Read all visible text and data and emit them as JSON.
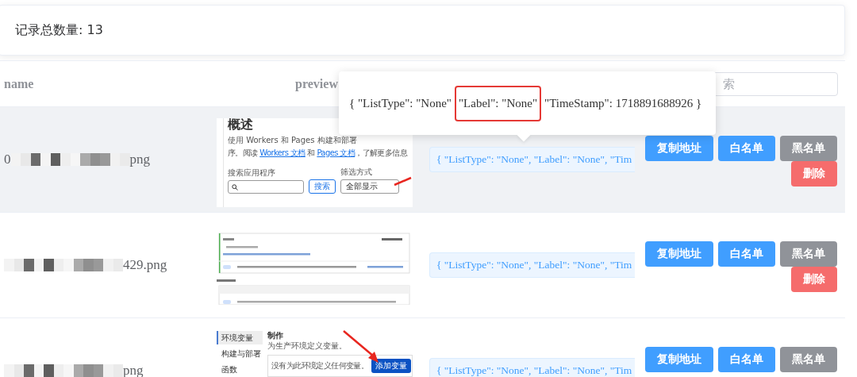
{
  "summary": {
    "label": "记录总数量: 13"
  },
  "table": {
    "columns": [
      {
        "label": "name"
      },
      {
        "label": "preview"
      }
    ],
    "search": {
      "placeholder": "索"
    },
    "rows": [
      {
        "highlighted": true,
        "name": {
          "prefix": "0",
          "suffix": "png"
        },
        "preview": {
          "kind": "overview",
          "title": "概述",
          "line_1": "使用 Workers 和 Pages 构建和部署",
          "line_2_start": "序。阅读 ",
          "link_1": "Workers 文档",
          "middle": " 和 ",
          "link_2": "Pages 文档",
          "line_2_end": "，了解更多信息",
          "search_label": "搜索应用程序",
          "search_button": "搜索",
          "filter_label": "筛选方式",
          "filter_value": "全部显示",
          "arrow": true
        },
        "metadata": "{ \"ListType\": \"None\", \"Label\": \"None\", \"Tim",
        "buttons": [
          {
            "label": "复制地址",
            "kind": "primary"
          },
          {
            "label": "白名单",
            "kind": "primary"
          },
          {
            "label": "黑名单",
            "kind": "info"
          },
          {
            "label": "删除",
            "kind": "danger"
          }
        ]
      },
      {
        "highlighted": false,
        "name": {
          "suffix": "429.png"
        },
        "preview": {
          "kind": "deployments"
        },
        "metadata": "{ \"ListType\": \"None\", \"Label\": \"None\", \"Tim",
        "buttons": [
          {
            "label": "复制地址",
            "kind": "primary"
          },
          {
            "label": "白名单",
            "kind": "primary"
          },
          {
            "label": "黑名单",
            "kind": "info"
          },
          {
            "label": "删除",
            "kind": "danger"
          }
        ]
      },
      {
        "highlighted": false,
        "name": {
          "suffix": "png"
        },
        "preview": {
          "kind": "variables",
          "nav": [
            {
              "label": "环境变量",
              "selected": true
            },
            {
              "label": "构建与部署",
              "selected": false
            },
            {
              "label": "函数",
              "selected": false
            }
          ],
          "heading": "制作",
          "subtitle": "为生产环境定义变量。",
          "empty": "没有为此环境定义任何变量。",
          "button": "添加变量",
          "arrow": true
        },
        "metadata": "{ \"ListType\": \"None\", \"Label\": \"None\", \"Tim",
        "buttons": [
          {
            "label": "复制地址",
            "kind": "primary"
          },
          {
            "label": "白名单",
            "kind": "primary"
          },
          {
            "label": "黑名单",
            "kind": "info"
          }
        ]
      }
    ]
  },
  "tooltip": {
    "segments": [
      {
        "text": "{ \"ListType\": \"None\"",
        "boxed": false
      },
      {
        "text": "\"Label\": \"None\"",
        "boxed": true
      },
      {
        "text": "\"TimeStamp\": 1718891688926 }",
        "boxed": false
      }
    ]
  }
}
